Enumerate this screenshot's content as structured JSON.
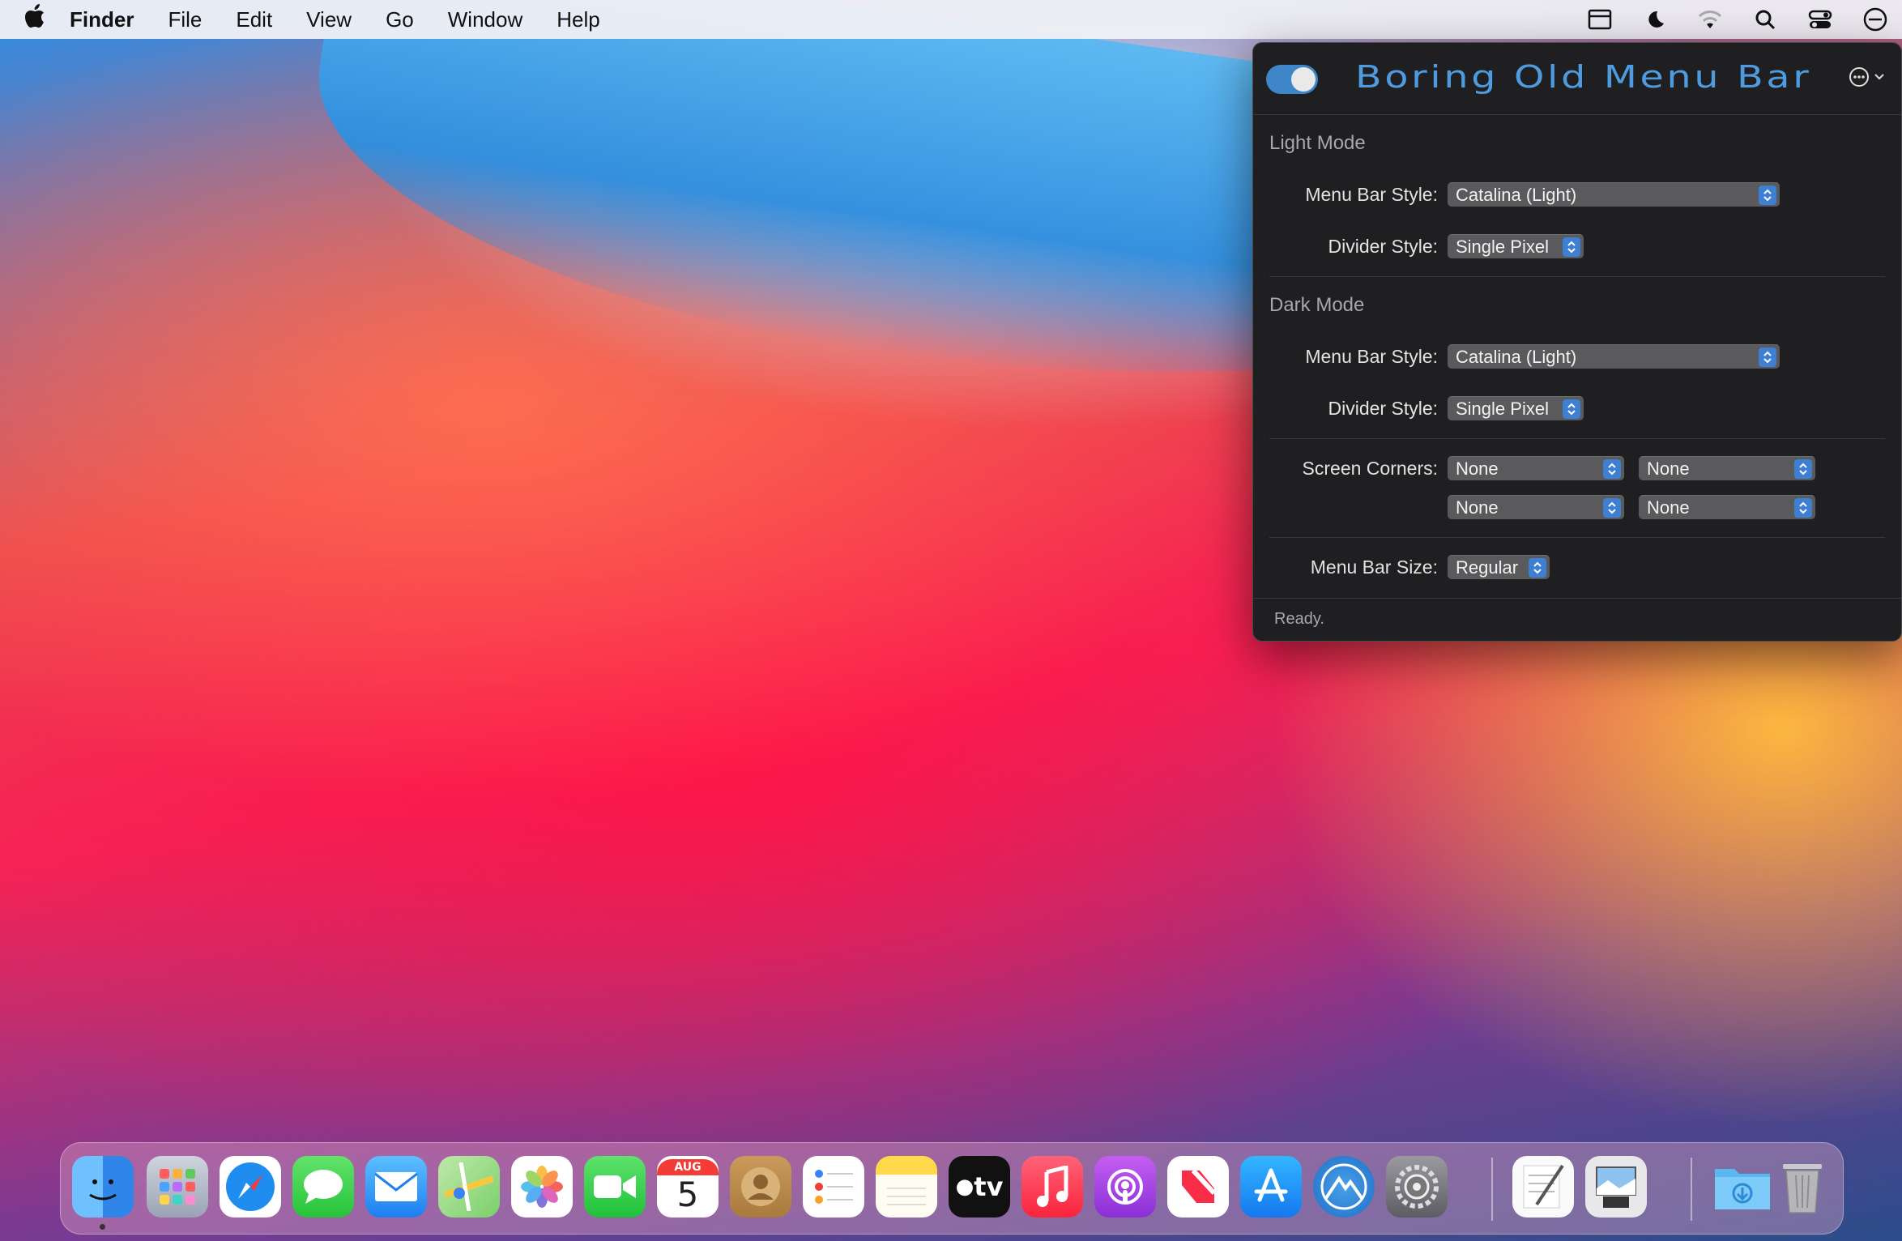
{
  "menubar": {
    "apple_icon": "apple-logo",
    "app_name": "Finder",
    "items": [
      "File",
      "Edit",
      "View",
      "Go",
      "Window",
      "Help"
    ],
    "status_icons": [
      "menu-bar-window-icon",
      "moon-icon",
      "wifi-icon",
      "search-icon",
      "control-center-icon",
      "boring-old-menu-bar-icon"
    ]
  },
  "panel": {
    "title": "Boring Old Menu Bar",
    "enabled": true,
    "light_mode": {
      "heading": "Light Mode",
      "menu_bar_style_label": "Menu Bar Style:",
      "menu_bar_style_value": "Catalina (Light)",
      "divider_style_label": "Divider Style:",
      "divider_style_value": "Single Pixel"
    },
    "dark_mode": {
      "heading": "Dark Mode",
      "menu_bar_style_label": "Menu Bar Style:",
      "menu_bar_style_value": "Catalina (Light)",
      "divider_style_label": "Divider Style:",
      "divider_style_value": "Single Pixel"
    },
    "screen_corners": {
      "label": "Screen Corners:",
      "top_left": "None",
      "top_right": "None",
      "bottom_left": "None",
      "bottom_right": "None"
    },
    "menu_bar_size": {
      "label": "Menu Bar Size:",
      "value": "Regular"
    },
    "status": "Ready."
  },
  "dock": {
    "apps": [
      "Finder",
      "Launchpad",
      "Safari",
      "Messages",
      "Mail",
      "Maps",
      "Photos",
      "FaceTime",
      "Calendar",
      "Contacts",
      "Reminders",
      "Notes",
      "TV",
      "Music",
      "Podcasts",
      "News",
      "App Store",
      "Boring Old Menu Bar",
      "System Preferences",
      "TextEdit",
      "Preview",
      "Downloads",
      "Trash"
    ],
    "calendar_month": "AUG",
    "calendar_day": "5",
    "tv_label": "tv"
  }
}
